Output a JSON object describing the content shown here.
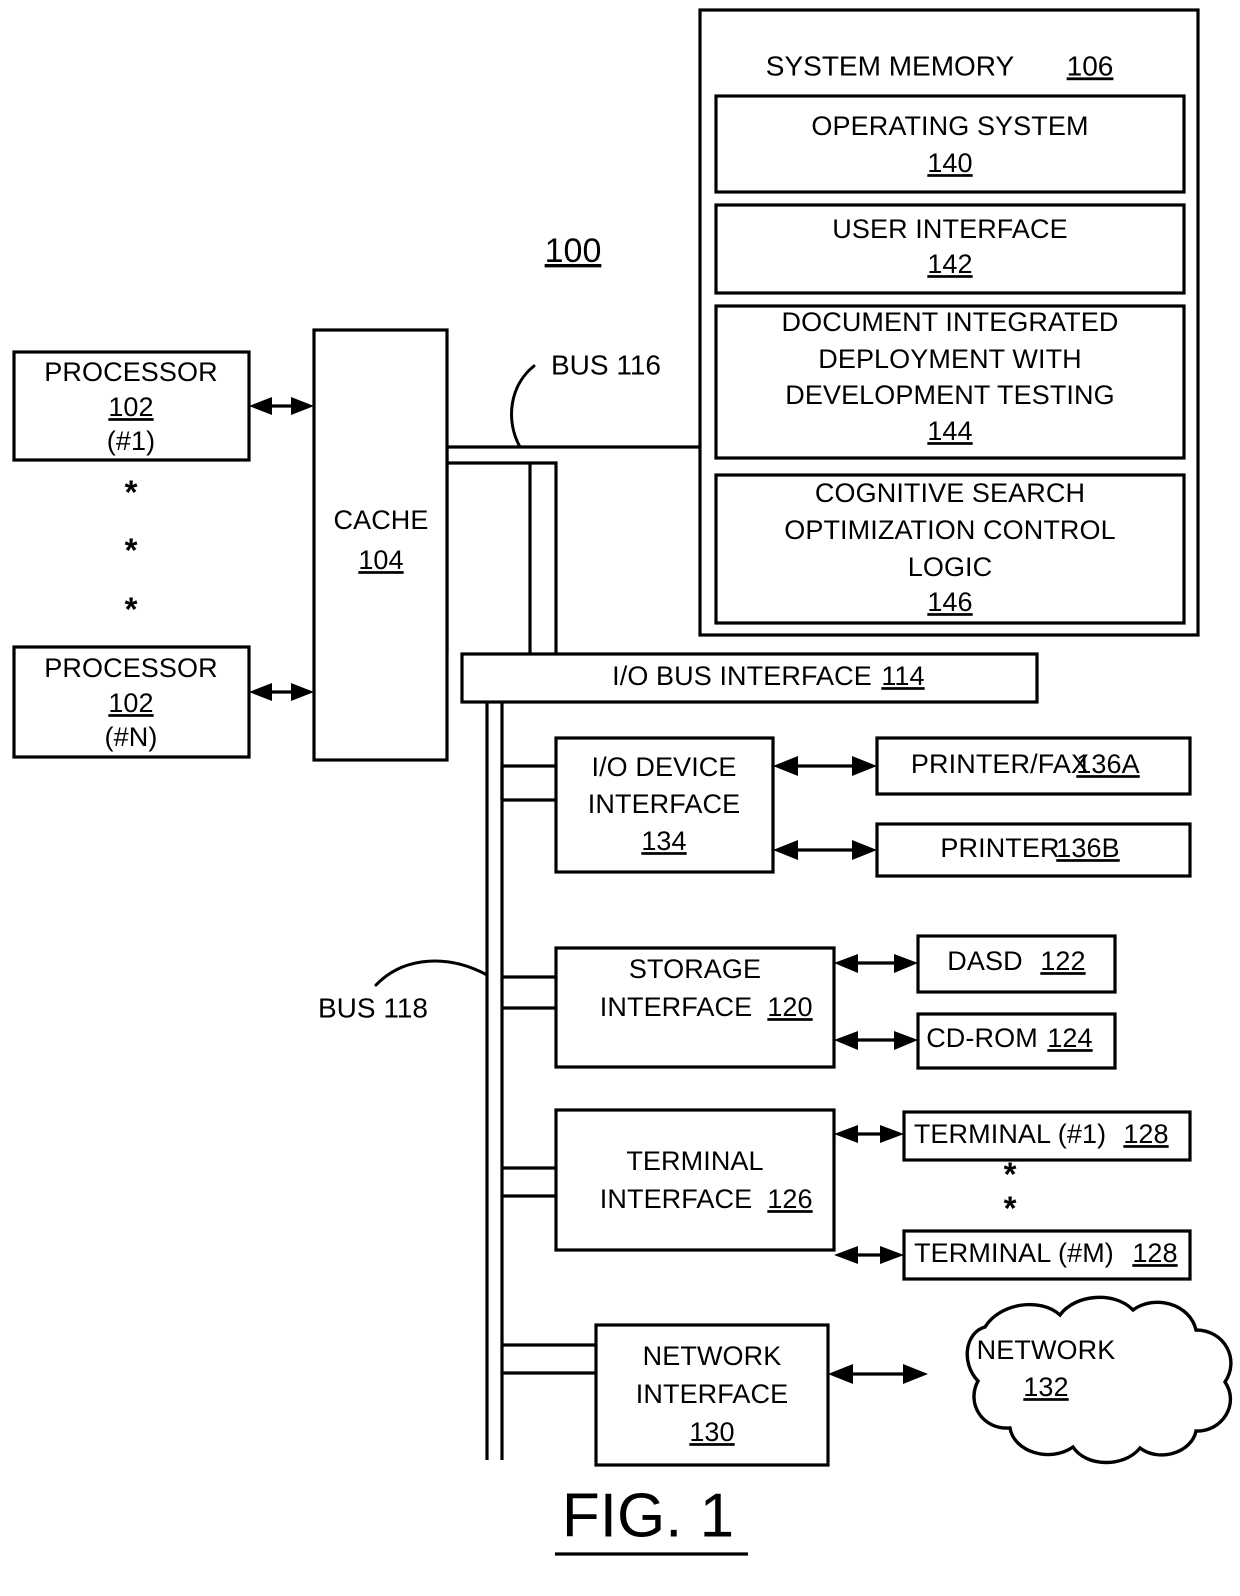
{
  "figure": {
    "caption": "FIG. 1",
    "system_ref": "100"
  },
  "processors": [
    {
      "name": "PROCESSOR",
      "ref": "102",
      "index": "(#1)"
    },
    {
      "name": "PROCESSOR",
      "ref": "102",
      "index": "(#N)"
    }
  ],
  "processor_ellipsis": [
    "*",
    "*",
    "*"
  ],
  "cache": {
    "name": "CACHE",
    "ref": "104"
  },
  "buses": [
    {
      "label": "BUS 116"
    },
    {
      "label": "BUS 118"
    }
  ],
  "system_memory": {
    "title": "SYSTEM MEMORY",
    "ref": "106",
    "modules": [
      {
        "lines": [
          "OPERATING SYSTEM"
        ],
        "ref": "140"
      },
      {
        "lines": [
          "USER INTERFACE"
        ],
        "ref": "142"
      },
      {
        "lines": [
          "DOCUMENT INTEGRATED",
          "DEPLOYMENT WITH",
          "DEVELOPMENT TESTING"
        ],
        "ref": "144"
      },
      {
        "lines": [
          "COGNITIVE SEARCH",
          "OPTIMIZATION CONTROL",
          "LOGIC"
        ],
        "ref": "146"
      }
    ]
  },
  "io_bus_interface": {
    "label": "I/O BUS INTERFACE",
    "ref": "114"
  },
  "io_device_interface": {
    "lines": [
      "I/O DEVICE",
      "INTERFACE"
    ],
    "ref": "134",
    "devices": [
      {
        "label": "PRINTER/FAX",
        "ref": "136A"
      },
      {
        "label": "PRINTER",
        "ref": "136B"
      }
    ]
  },
  "storage_interface": {
    "line1": "STORAGE",
    "line2_label": "INTERFACE",
    "ref": "120",
    "devices": [
      {
        "label": "DASD",
        "ref": "122"
      },
      {
        "label": "CD-ROM",
        "ref": "124"
      }
    ]
  },
  "terminal_interface": {
    "line1": "TERMINAL",
    "line2_label": "INTERFACE",
    "ref": "126",
    "terminals": [
      {
        "label": "TERMINAL (#1)",
        "ref": "128"
      },
      {
        "label": "TERMINAL (#M)",
        "ref": "128"
      }
    ],
    "ellipsis": [
      "*",
      "*"
    ]
  },
  "network_interface": {
    "lines": [
      "NETWORK",
      "INTERFACE"
    ],
    "ref": "130",
    "network": {
      "label": "NETWORK",
      "ref": "132"
    }
  },
  "colors": {
    "stroke": "#000000",
    "fill": "#ffffff"
  }
}
